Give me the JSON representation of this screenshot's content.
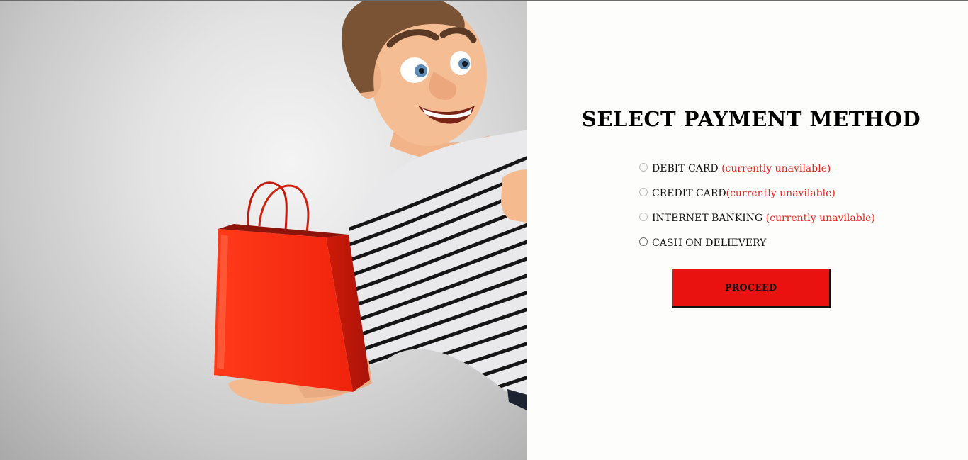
{
  "payment": {
    "title": "SELECT PAYMENT METHOD",
    "options": [
      {
        "label": "DEBIT CARD",
        "note": " (currently unavilable)",
        "enabled": false,
        "checked": false
      },
      {
        "label": "CREDIT CARD",
        "note": "(currently unavilable)",
        "enabled": false,
        "checked": false
      },
      {
        "label": "INTERNET BANKING",
        "note": " (currently unavilable)",
        "enabled": false,
        "checked": false
      },
      {
        "label": "CASH ON DELIEVERY",
        "note": "",
        "enabled": true,
        "checked": false
      }
    ],
    "proceed_label": "PROCEED"
  },
  "colors": {
    "accent": "#ea1111",
    "note_text": "#e8241b",
    "panel_background": "#fdfdfc"
  },
  "hero": {
    "icon": "cartoon-man-with-shopping-bag-illustration"
  }
}
